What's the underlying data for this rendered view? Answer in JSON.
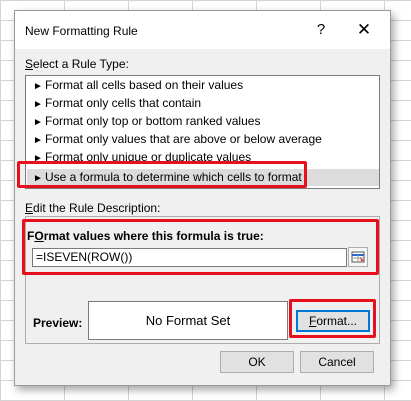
{
  "dialog": {
    "title": "New Formatting Rule",
    "help_icon": "question-mark",
    "close_icon": "close-x"
  },
  "rule_type": {
    "label_mnemonic": "S",
    "label_rest": "elect a Rule Type:",
    "items": [
      {
        "label": "Format all cells based on their values"
      },
      {
        "label": "Format only cells that contain"
      },
      {
        "label": "Format only top or bottom ranked values"
      },
      {
        "label": "Format only values that are above or below average"
      },
      {
        "label": "Format only unique or duplicate values"
      },
      {
        "label": "Use a formula to determine which cells to format"
      }
    ],
    "selected_index": 5,
    "arrow_glyph": "►"
  },
  "description": {
    "label_mnemonic": "E",
    "label_rest": "dit the Rule Description:",
    "formula_label_mnemonic": "O",
    "formula_label_pre": "F",
    "formula_label_rest": "rmat values where this formula is true:",
    "formula_value": "=ISEVEN(ROW())"
  },
  "preview": {
    "label": "Preview:",
    "text": "No Format Set"
  },
  "buttons": {
    "format_mnemonic": "F",
    "format_rest": "ormat...",
    "ok": "OK",
    "cancel": "Cancel"
  },
  "colors": {
    "highlight": "#e8101d",
    "dialog_bg": "#f0f0f0",
    "selected_row": "#dcdcdc",
    "focus_blue": "#0078d7"
  }
}
